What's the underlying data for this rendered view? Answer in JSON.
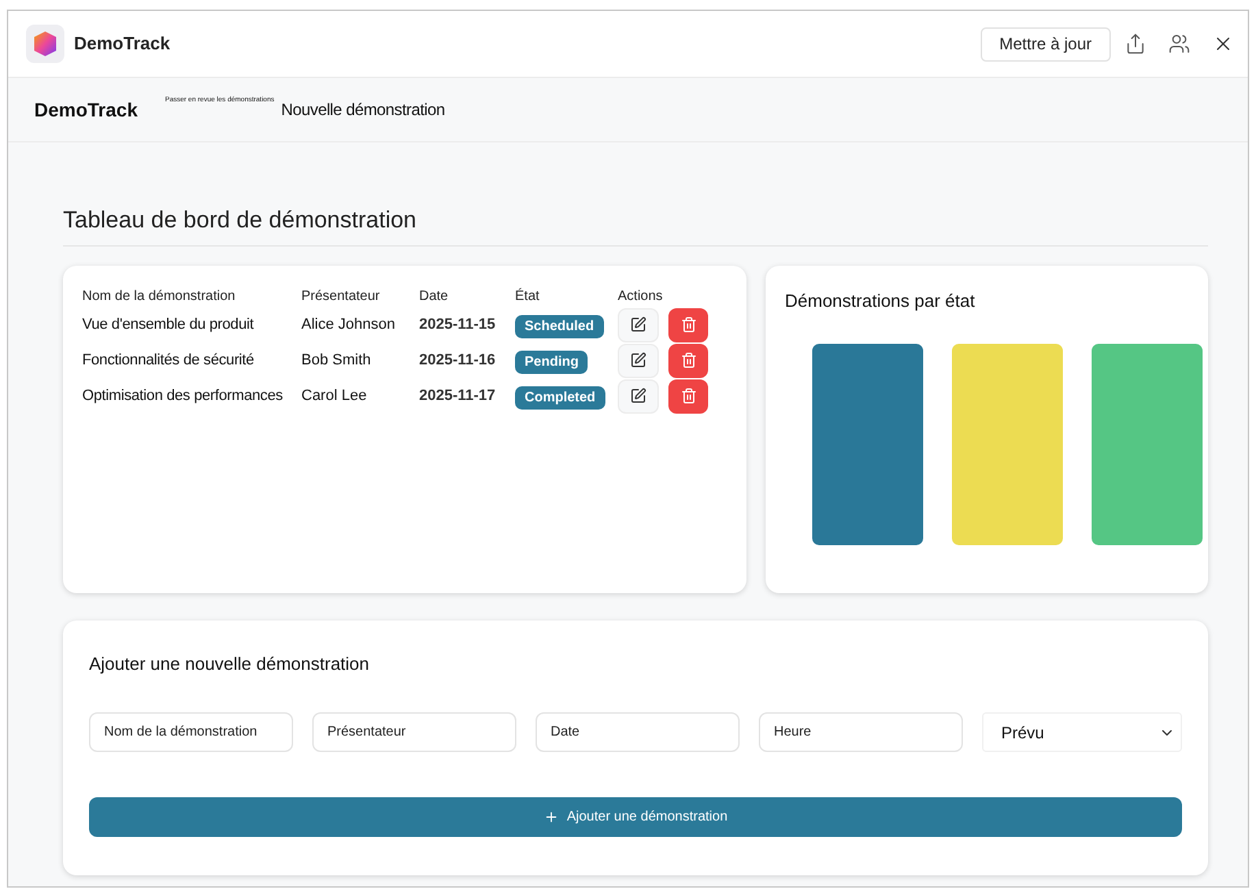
{
  "window": {
    "app_name": "DemoTrack",
    "update_button": "Mettre à jour"
  },
  "nav": {
    "brand": "DemoTrack",
    "review_link": "Passer en revue les démonstrations",
    "new_link": "Nouvelle démonstration"
  },
  "dashboard": {
    "title": "Tableau de bord de démonstration",
    "table": {
      "columns": [
        "Nom de la démonstration",
        "Présentateur",
        "Date",
        "État",
        "Actions"
      ],
      "rows": [
        {
          "name": "Vue d'ensemble du produit",
          "presenter": "Alice Johnson",
          "date": "2025-11-15",
          "status": "Scheduled"
        },
        {
          "name": "Fonctionnalités de sécurité",
          "presenter": "Bob Smith",
          "date": "2025-11-16",
          "status": "Pending"
        },
        {
          "name": "Optimisation des performances",
          "presenter": "Carol Lee",
          "date": "2025-11-17",
          "status": "Completed"
        }
      ]
    },
    "chart": {
      "title": "Démonstrations par état",
      "bars": [
        {
          "color": "#2a7898"
        },
        {
          "color": "#ecdc52"
        },
        {
          "color": "#55c684"
        }
      ]
    }
  },
  "form": {
    "title": "Ajouter une nouvelle démonstration",
    "fields": [
      {
        "placeholder": "Nom de la démonstration"
      },
      {
        "placeholder": "Présentateur"
      },
      {
        "placeholder": "Date"
      },
      {
        "placeholder": "Heure"
      }
    ],
    "select": {
      "value": "Prévu"
    },
    "submit_button": "Ajouter une démonstration"
  }
}
